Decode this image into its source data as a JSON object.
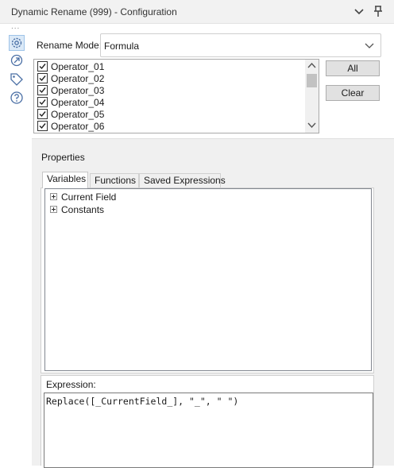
{
  "window": {
    "title": "Dynamic Rename (999) - Configuration",
    "overflow_dots": "..."
  },
  "sidebar": {
    "icons": [
      "gear-icon",
      "connection-icon",
      "tag-icon",
      "help-icon"
    ],
    "active": "gear-icon"
  },
  "rename_mode": {
    "label": "Rename Mode:",
    "value": "Formula"
  },
  "operators": {
    "items": [
      {
        "label": "Operator_01",
        "checked": true
      },
      {
        "label": "Operator_02",
        "checked": true
      },
      {
        "label": "Operator_03",
        "checked": true
      },
      {
        "label": "Operator_04",
        "checked": true
      },
      {
        "label": "Operator_05",
        "checked": true
      },
      {
        "label": "Operator_06",
        "checked": true
      }
    ]
  },
  "buttons": {
    "all_label": "All",
    "clear_label": "Clear"
  },
  "properties": {
    "title": "Properties",
    "tabs": [
      {
        "label": "Variables",
        "active": true
      },
      {
        "label": "Functions",
        "active": false
      },
      {
        "label": "Saved Expressions",
        "active": false
      }
    ],
    "tree": [
      {
        "label": "Current Field"
      },
      {
        "label": "Constants"
      }
    ],
    "expression": {
      "label": "Expression:",
      "value": "Replace([_CurrentField_], \"_\", \" \")"
    }
  },
  "colors": {
    "titlebar_bg": "#f2f2f2",
    "panel_bg": "#f0f0f0",
    "active_icon_bg": "#dbe9f7",
    "icon_stroke": "#4a6fa5"
  }
}
